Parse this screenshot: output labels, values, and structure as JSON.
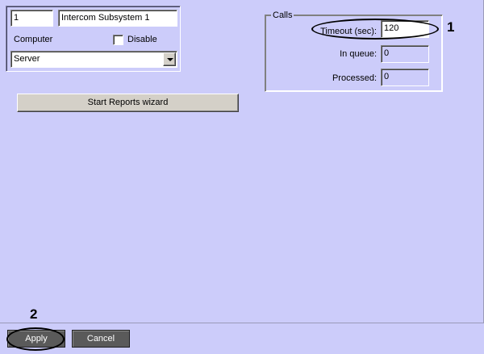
{
  "object": {
    "id_value": "1",
    "name_value": "Intercom Subsystem 1",
    "computer_label": "Computer",
    "disable_label": "Disable",
    "disable_checked": false,
    "computer_select_value": "Server"
  },
  "calls": {
    "legend": "Calls",
    "timeout_label": "Timeout (sec):",
    "timeout_value": "120",
    "in_queue_label": "In queue:",
    "in_queue_value": "0",
    "processed_label": "Processed:",
    "processed_value": "0"
  },
  "reports_button_label": "Start Reports wizard",
  "footer": {
    "apply_label": "Apply",
    "cancel_label": "Cancel"
  },
  "callouts": {
    "one": "1",
    "two": "2"
  },
  "colors": {
    "panel_background": "#ccccfa",
    "button_dark": "#5a5a5a"
  }
}
